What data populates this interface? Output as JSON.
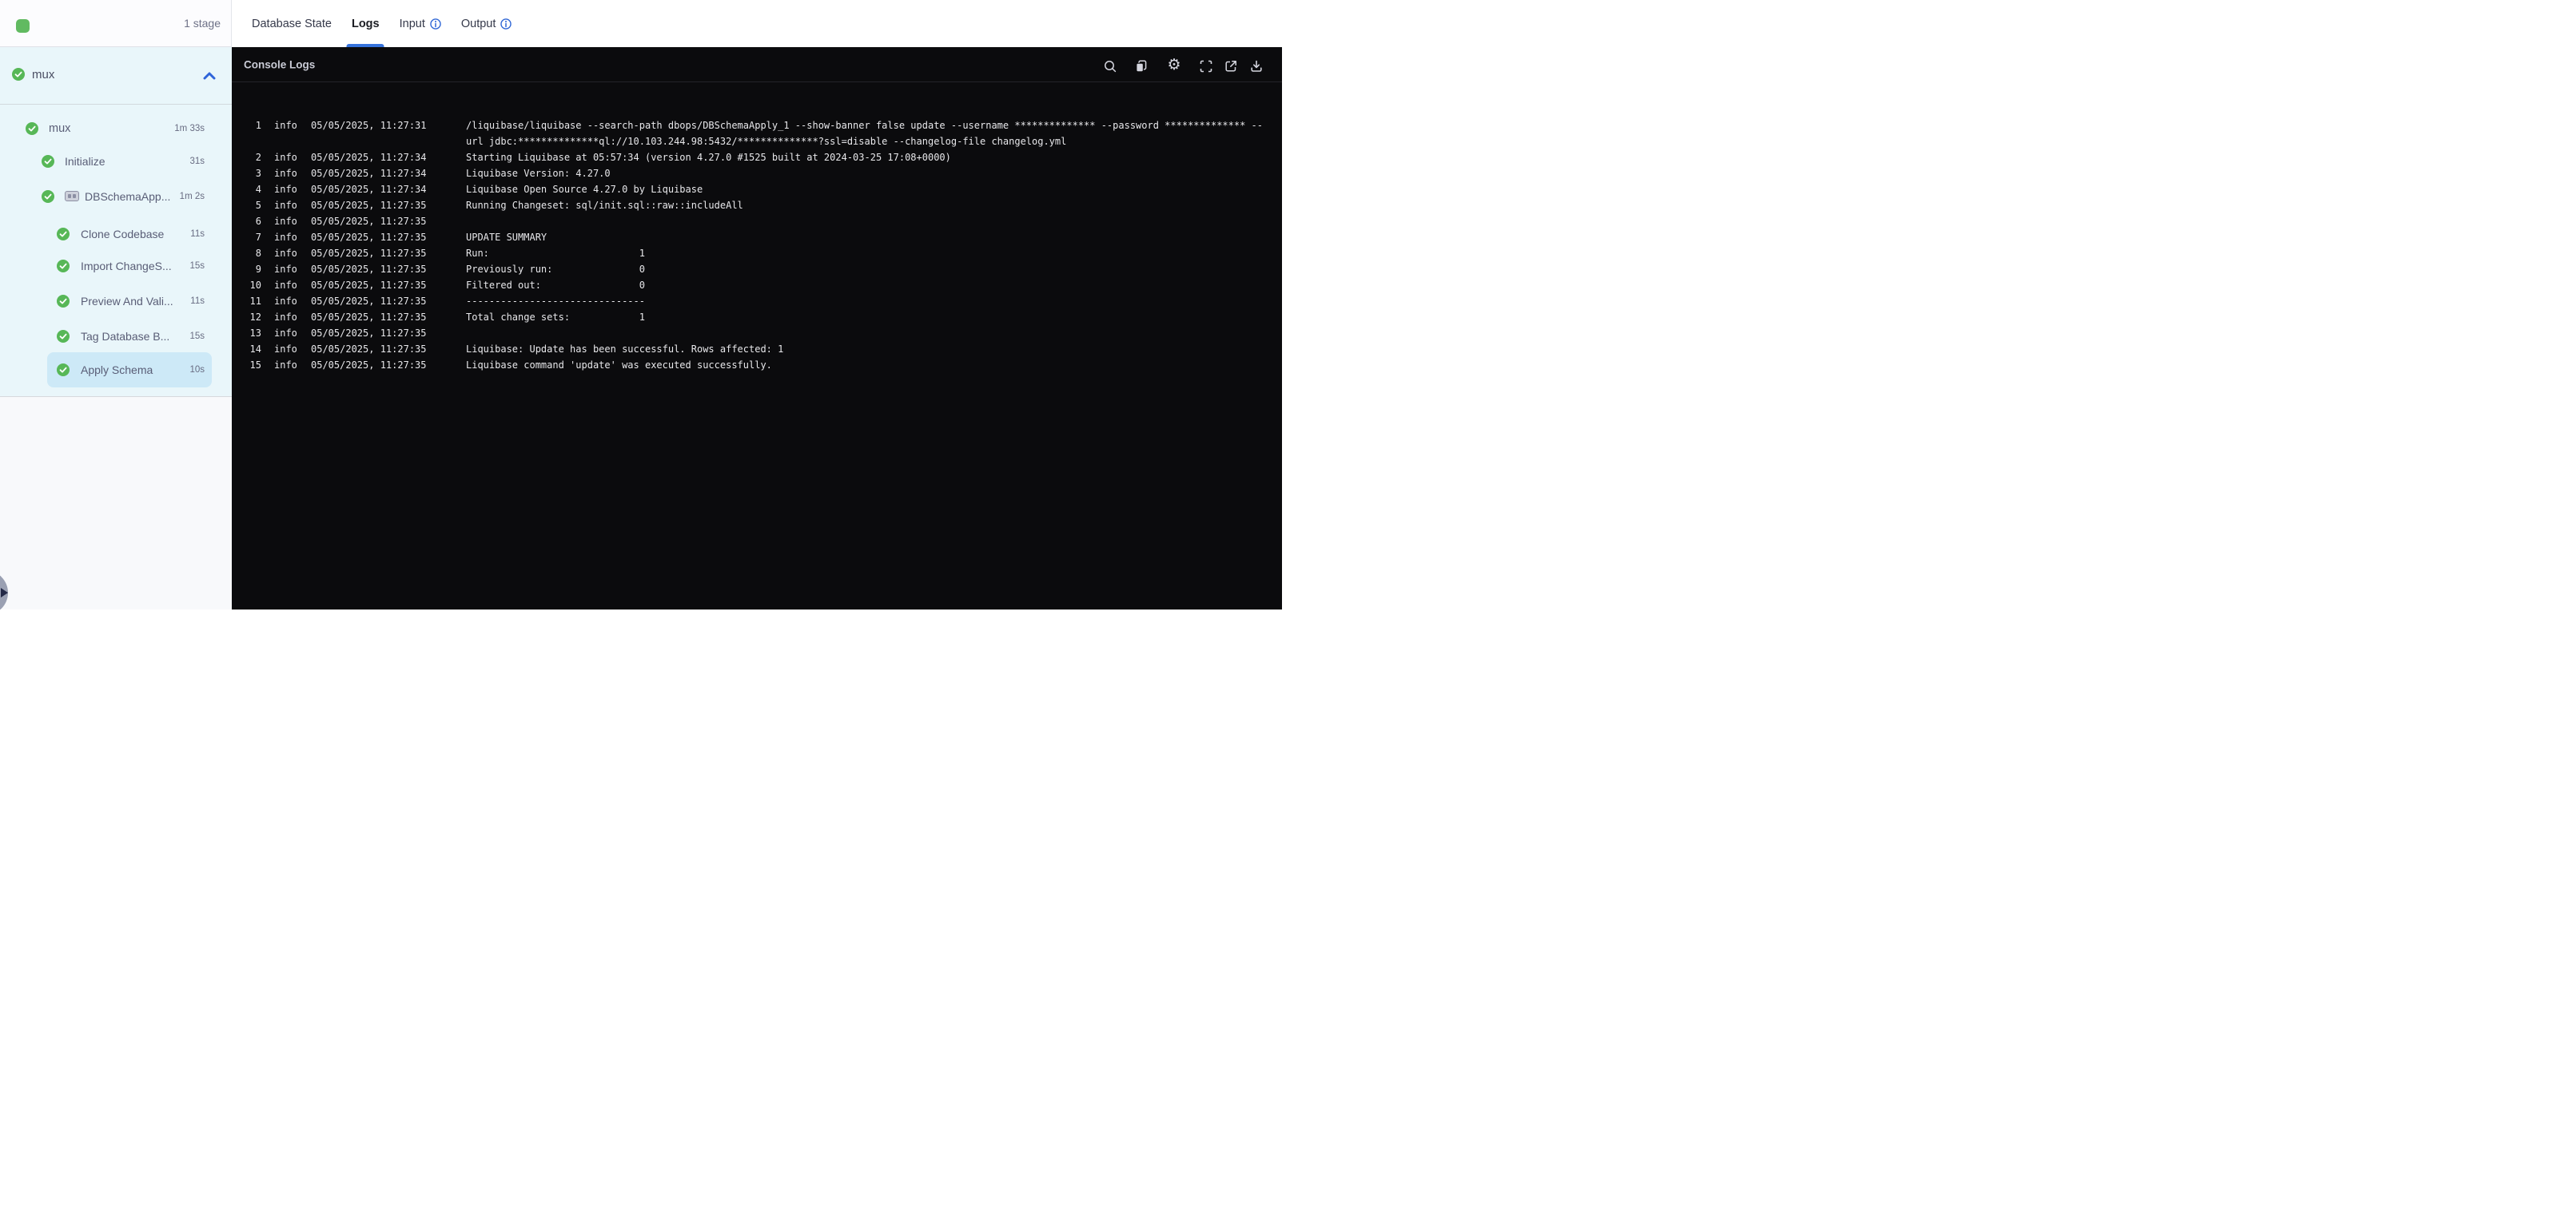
{
  "topbar": {
    "stage_count": "1 stage"
  },
  "tabs": [
    {
      "label": "Database State",
      "active": false,
      "info": false
    },
    {
      "label": "Logs",
      "active": true,
      "info": false
    },
    {
      "label": "Input",
      "active": false,
      "info": true
    },
    {
      "label": "Output",
      "active": false,
      "info": true
    }
  ],
  "sidebar": {
    "stage_name": "mux",
    "stage_status": "success",
    "tree": [
      {
        "label": "mux",
        "duration": "1m 33s",
        "level": 0,
        "status": "success"
      },
      {
        "label": "Initialize",
        "duration": "31s",
        "level": 1,
        "status": "success"
      },
      {
        "label": "DBSchemaApp...",
        "duration": "1m 2s",
        "level": 1,
        "status": "success",
        "group_icon": true
      },
      {
        "label": "Clone Codebase",
        "duration": "11s",
        "level": 2,
        "status": "success"
      },
      {
        "label": "Import ChangeS...",
        "duration": "15s",
        "level": 2,
        "status": "success"
      },
      {
        "label": "Preview And Vali...",
        "duration": "11s",
        "level": 2,
        "status": "success"
      },
      {
        "label": "Tag Database B...",
        "duration": "15s",
        "level": 2,
        "status": "success"
      },
      {
        "label": "Apply Schema",
        "duration": "10s",
        "level": 2,
        "status": "success",
        "selected": true
      }
    ]
  },
  "console": {
    "title": "Console Logs",
    "toolbar_icons": [
      "search-icon",
      "copy-icon",
      "settings-icon",
      "fullscreen-icon",
      "open-in-new-icon",
      "download-icon"
    ],
    "logs": [
      {
        "n": "1",
        "level": "info",
        "ts": "05/05/2025, 11:27:31",
        "msg": "/liquibase/liquibase --search-path dbops/DBSchemaApply_1 --show-banner false update --username ************** --password ************** --\nurl jdbc:**************ql://10.103.244.98:5432/**************?ssl=disable --changelog-file changelog.yml"
      },
      {
        "n": "2",
        "level": "info",
        "ts": "05/05/2025, 11:27:34",
        "msg": "Starting Liquibase at 05:57:34 (version 4.27.0 #1525 built at 2024-03-25 17:08+0000)"
      },
      {
        "n": "3",
        "level": "info",
        "ts": "05/05/2025, 11:27:34",
        "msg": "Liquibase Version: 4.27.0"
      },
      {
        "n": "4",
        "level": "info",
        "ts": "05/05/2025, 11:27:34",
        "msg": "Liquibase Open Source 4.27.0 by Liquibase"
      },
      {
        "n": "5",
        "level": "info",
        "ts": "05/05/2025, 11:27:35",
        "msg": "Running Changeset: sql/init.sql::raw::includeAll"
      },
      {
        "n": "6",
        "level": "info",
        "ts": "05/05/2025, 11:27:35",
        "msg": ""
      },
      {
        "n": "7",
        "level": "info",
        "ts": "05/05/2025, 11:27:35",
        "msg": "UPDATE SUMMARY"
      },
      {
        "n": "8",
        "level": "info",
        "ts": "05/05/2025, 11:27:35",
        "msg": "Run:                          1"
      },
      {
        "n": "9",
        "level": "info",
        "ts": "05/05/2025, 11:27:35",
        "msg": "Previously run:               0"
      },
      {
        "n": "10",
        "level": "info",
        "ts": "05/05/2025, 11:27:35",
        "msg": "Filtered out:                 0"
      },
      {
        "n": "11",
        "level": "info",
        "ts": "05/05/2025, 11:27:35",
        "msg": "-------------------------------"
      },
      {
        "n": "12",
        "level": "info",
        "ts": "05/05/2025, 11:27:35",
        "msg": "Total change sets:            1"
      },
      {
        "n": "13",
        "level": "info",
        "ts": "05/05/2025, 11:27:35",
        "msg": ""
      },
      {
        "n": "14",
        "level": "info",
        "ts": "05/05/2025, 11:27:35",
        "msg": "Liquibase: Update has been successful. Rows affected: 1"
      },
      {
        "n": "15",
        "level": "info",
        "ts": "05/05/2025, 11:27:35",
        "msg": "Liquibase command 'update' was executed successfully."
      }
    ]
  },
  "colors": {
    "success_green": "#57b757",
    "accent_blue": "#3673dc",
    "selected_row": "#cde9f7",
    "sidebar_bg": "#e9f6fa",
    "console_bg": "#0b0b0d"
  }
}
